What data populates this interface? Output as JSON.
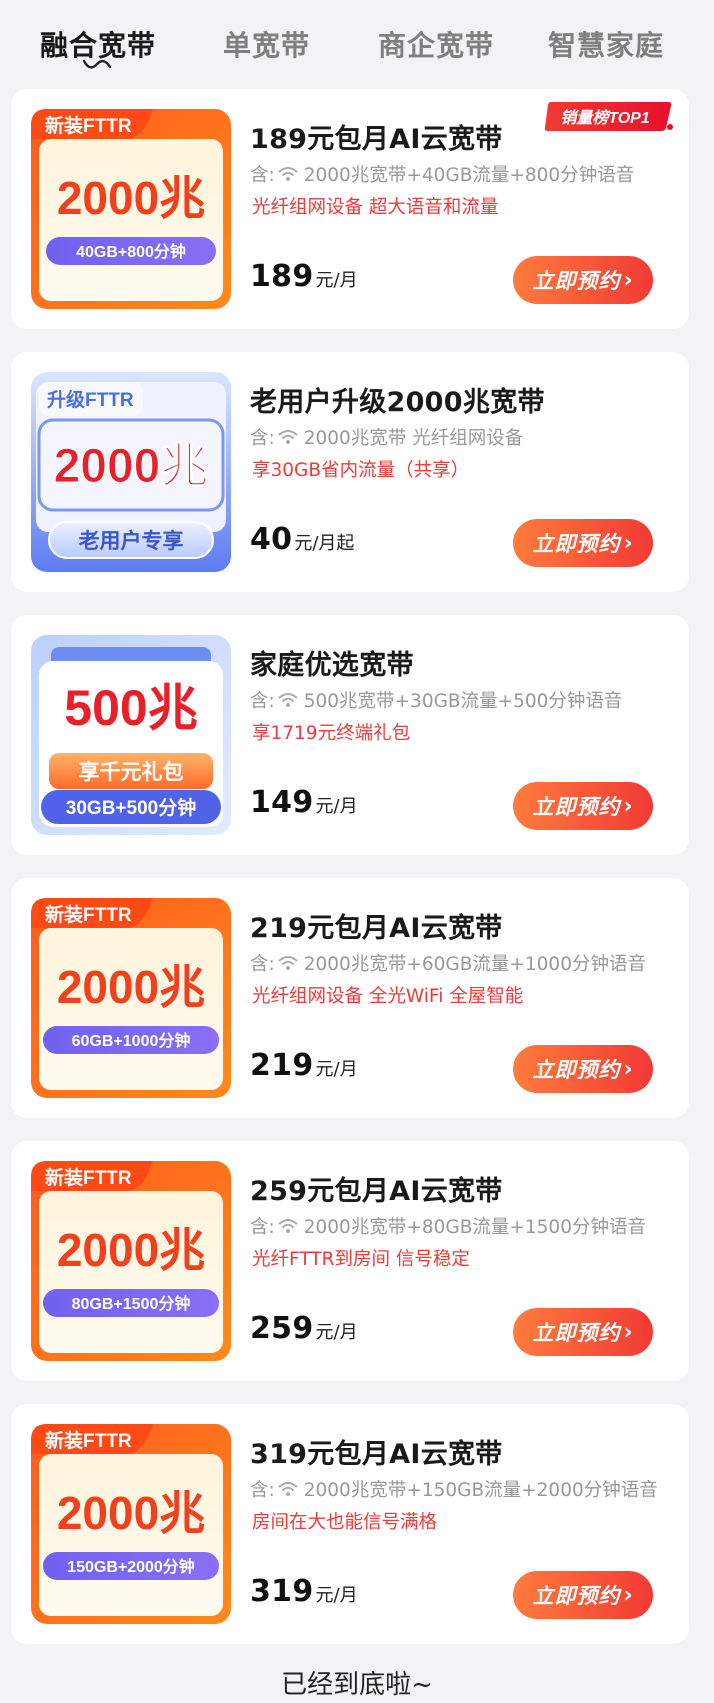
{
  "tabs": [
    {
      "label": "融合宽带",
      "active": true
    },
    {
      "label": "单宽带",
      "active": false
    },
    {
      "label": "商企宽带",
      "active": false
    },
    {
      "label": "智慧家庭",
      "active": false
    }
  ],
  "sub_prefix": "含:",
  "cta_label": "立即预约",
  "products": [
    {
      "style": "orange",
      "tag": "新装FTTR",
      "speed": "2000兆",
      "pill": "40GB+800分钟",
      "badge": "销量榜TOP1",
      "title": "189元包月AI云宽带",
      "includes": "2000兆宽带+40GB流量+800分钟语音",
      "note": "光纤组网设备 超大语音和流量",
      "price": "189",
      "unit": "元/月"
    },
    {
      "style": "blue",
      "tag": "升级FTTR",
      "speed": "2000兆",
      "pill": "老用户专享",
      "badge": "",
      "title": "老用户升级2000兆宽带",
      "includes": "2000兆宽带 光纤组网设备",
      "note": "享30GB省内流量（共享）",
      "price": "40",
      "unit": "元/月起"
    },
    {
      "style": "light",
      "tag": "",
      "speed": "500兆",
      "pill": "30GB+500分钟",
      "gift": "享千元礼包",
      "badge": "",
      "title": "家庭优选宽带",
      "includes": "500兆宽带+30GB流量+500分钟语音",
      "note": "享1719元终端礼包",
      "price": "149",
      "unit": "元/月"
    },
    {
      "style": "orange",
      "tag": "新装FTTR",
      "speed": "2000兆",
      "pill": "60GB+1000分钟",
      "badge": "",
      "title": "219元包月AI云宽带",
      "includes": "2000兆宽带+60GB流量+1000分钟语音",
      "note": "光纤组网设备 全光WiFi 全屋智能",
      "price": "219",
      "unit": "元/月"
    },
    {
      "style": "orange",
      "tag": "新装FTTR",
      "speed": "2000兆",
      "pill": "80GB+1500分钟",
      "badge": "",
      "title": "259元包月AI云宽带",
      "includes": "2000兆宽带+80GB流量+1500分钟语音",
      "note": "光纤FTTR到房间 信号稳定",
      "price": "259",
      "unit": "元/月"
    },
    {
      "style": "orange",
      "tag": "新装FTTR",
      "speed": "2000兆",
      "pill": "150GB+2000分钟",
      "badge": "",
      "title": "319元包月AI云宽带",
      "includes": "2000兆宽带+150GB流量+2000分钟语音",
      "note": "房间在大也能信号满格",
      "price": "319",
      "unit": "元/月"
    }
  ],
  "footer": "已经到底啦~",
  "colors": {
    "accent_red": "#ef3b3b",
    "button_start": "#ff7b3d",
    "button_end": "#f23a35",
    "page_bg": "#f3f3f5"
  }
}
